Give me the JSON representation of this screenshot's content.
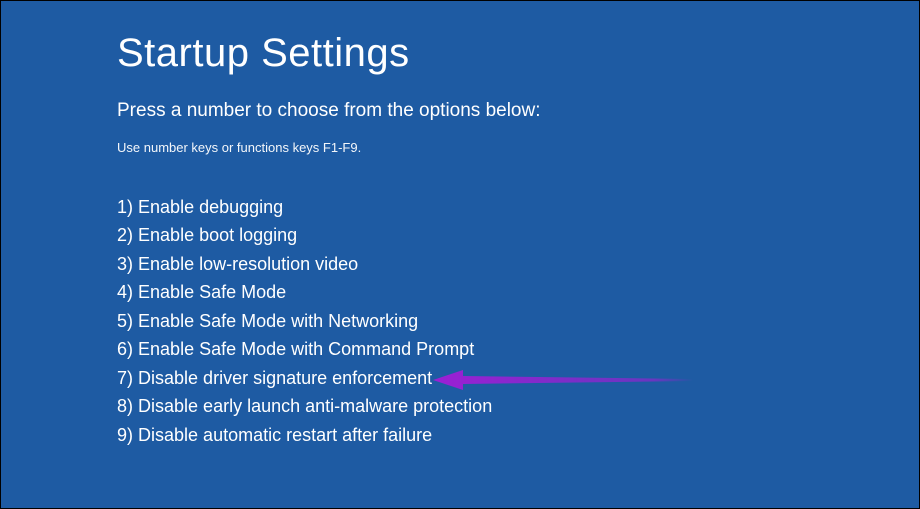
{
  "title": "Startup Settings",
  "subtitle": "Press a number to choose from the options below:",
  "hint": "Use number keys or functions keys F1-F9.",
  "options": [
    {
      "num": "1)",
      "label": "Enable debugging"
    },
    {
      "num": "2)",
      "label": "Enable boot logging"
    },
    {
      "num": "3)",
      "label": "Enable low-resolution video"
    },
    {
      "num": "4)",
      "label": "Enable Safe Mode"
    },
    {
      "num": "5)",
      "label": "Enable Safe Mode with Networking"
    },
    {
      "num": "6)",
      "label": "Enable Safe Mode with Command Prompt"
    },
    {
      "num": "7)",
      "label": "Disable driver signature enforcement"
    },
    {
      "num": "8)",
      "label": "Disable early launch anti-malware protection"
    },
    {
      "num": "9)",
      "label": "Disable automatic restart after failure"
    }
  ],
  "annotation_arrow_color": "#9b1fd4"
}
